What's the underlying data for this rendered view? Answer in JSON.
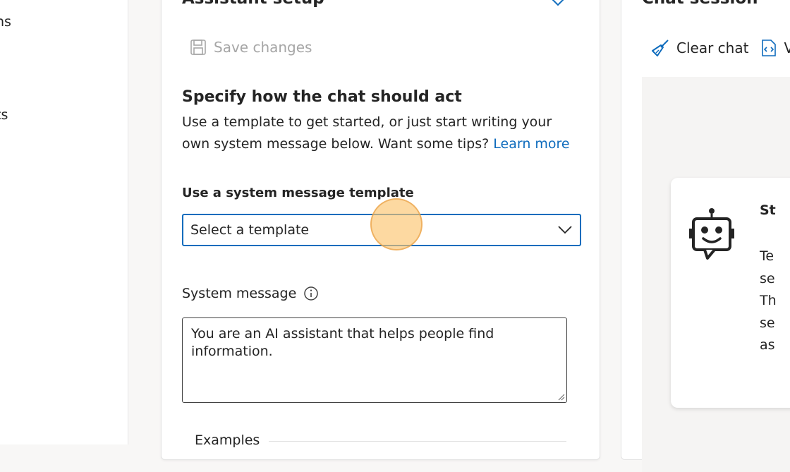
{
  "left_nav": {
    "items": [
      {
        "label": "ns"
      },
      {
        "label": "ts"
      }
    ]
  },
  "setup_panel": {
    "title": "Assistant setup",
    "save_label": "Save changes",
    "heading": "Specify how the chat should act",
    "description": "Use a template to get started, or just start writing your own system message below. Want some tips?",
    "learn_more": "Learn more",
    "template_label": "Use a system message template",
    "template_selected": "Select a template",
    "system_message_label": "System message",
    "system_message_value": "You are an AI assistant that helps people find information.",
    "examples_label": "Examples"
  },
  "chat_panel": {
    "title": "Chat session",
    "clear_chat": "Clear chat",
    "view_code": "V",
    "card_title": "St",
    "card_lines": [
      "Te",
      "se",
      "Th",
      "se",
      "as"
    ]
  },
  "colors": {
    "accent": "#0f6cbd",
    "cursor_highlight": "#fcc46e"
  },
  "icons": {
    "close": "close-icon",
    "save": "save-icon",
    "info": "info-icon",
    "chevron": "chevron-down-icon",
    "broom": "broom-icon",
    "code": "code-icon",
    "bot": "bot-icon"
  }
}
